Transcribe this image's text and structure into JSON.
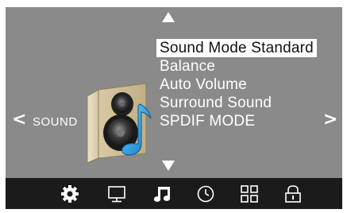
{
  "section": {
    "label": "SOUND",
    "prev_glyph": "<",
    "next_glyph": ">"
  },
  "menu": {
    "items": [
      {
        "label": "Sound Mode Standard",
        "selected": true
      },
      {
        "label": "Balance",
        "selected": false
      },
      {
        "label": "Auto Volume",
        "selected": false
      },
      {
        "label": "Surround Sound",
        "selected": false
      },
      {
        "label": "SPDIF MODE",
        "selected": false
      }
    ]
  },
  "bottom_bar": {
    "icons": [
      "gear-icon",
      "monitor-icon",
      "music-note-icon",
      "clock-icon",
      "grid-icon",
      "lock-icon"
    ],
    "active": "music-note-icon"
  },
  "colors": {
    "background": "#8a8a8a",
    "bar": "#1b1b1b",
    "text": "#ffffff",
    "highlight": "#ffffff",
    "accent": "#2aa3e0"
  }
}
